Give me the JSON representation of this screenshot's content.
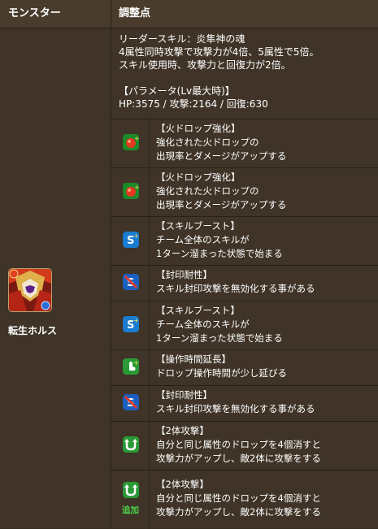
{
  "header": {
    "col_monster": "モンスター",
    "col_adjust": "調整点"
  },
  "monster": {
    "name": "転生ホルス"
  },
  "leader": {
    "lines": [
      "リーダースキル：炎隼神の魂",
      "4属性同時攻撃で攻撃力が4倍、5属性で5倍。",
      "スキル使用時、攻撃力と回復力が2倍。",
      "",
      "【パラメータ(Lv最大時)】",
      "HP:3575 / 攻撃:2164 / 回復:630"
    ]
  },
  "awakenings": [
    {
      "icon": "fire-drop-enhance-icon",
      "title": "【火ドロップ強化】",
      "lines": [
        "強化された火ドロップの",
        "出現率とダメージがアップする"
      ]
    },
    {
      "icon": "fire-drop-enhance-icon",
      "title": "【火ドロップ強化】",
      "lines": [
        "強化された火ドロップの",
        "出現率とダメージがアップする"
      ]
    },
    {
      "icon": "skill-boost-icon",
      "title": "【スキルブースト】",
      "lines": [
        "チーム全体のスキルが",
        "1ターン溜まった状態で始まる"
      ]
    },
    {
      "icon": "bind-resist-icon",
      "title": "【封印耐性】",
      "lines": [
        "スキル封印攻撃を無効化する事がある"
      ]
    },
    {
      "icon": "skill-boost-icon",
      "title": "【スキルブースト】",
      "lines": [
        "チーム全体のスキルが",
        "1ターン溜まった状態で始まる"
      ]
    },
    {
      "icon": "time-extend-icon",
      "title": "【操作時間延長】",
      "lines": [
        "ドロップ操作時間が少し延びる"
      ]
    },
    {
      "icon": "bind-resist-icon",
      "title": "【封印耐性】",
      "lines": [
        "スキル封印攻撃を無効化する事がある"
      ]
    },
    {
      "icon": "two-pronged-attack-icon",
      "title": "【2体攻撃】",
      "lines": [
        "自分と同じ属性のドロップを4個消すと",
        "攻撃力がアップし、敵2体に攻撃をする"
      ]
    },
    {
      "icon": "two-pronged-attack-icon",
      "title": "【2体攻撃】",
      "lines": [
        "自分と同じ属性のドロップを4個消すと",
        "攻撃力がアップし、敵2体に攻撃をする"
      ],
      "note": "追加"
    }
  ],
  "colors": {
    "header_bg": "#4a3c2d",
    "row_bg": "#3f3427",
    "added_label": "#4dd34d"
  }
}
